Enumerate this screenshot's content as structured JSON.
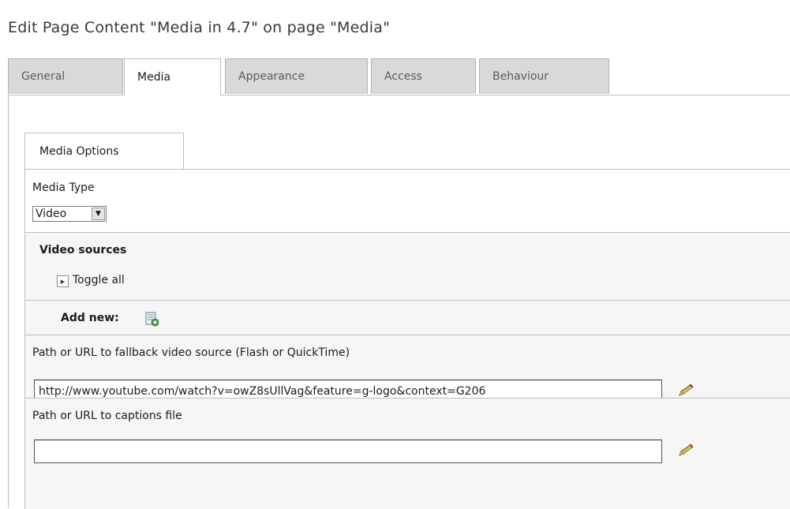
{
  "page": {
    "title": "Edit Page Content \"Media in 4.7\" on page \"Media\""
  },
  "tabs": [
    {
      "label": "General"
    },
    {
      "label": "Media"
    },
    {
      "label": "Appearance"
    },
    {
      "label": "Access"
    },
    {
      "label": "Behaviour"
    }
  ],
  "subtab": {
    "label": "Media Options"
  },
  "media_type": {
    "label": "Media Type",
    "selected": "Video"
  },
  "video_sources": {
    "heading": "Video sources",
    "toggle_label": "Toggle all"
  },
  "add_new": {
    "label": "Add new:"
  },
  "fallback": {
    "label": "Path or URL to fallback video source (Flash or QuickTime)",
    "value": "http://www.youtube.com/watch?v=owZ8sUllVag&feature=g-logo&context=G206"
  },
  "captions": {
    "label": "Path or URL to captions file",
    "value": ""
  }
}
